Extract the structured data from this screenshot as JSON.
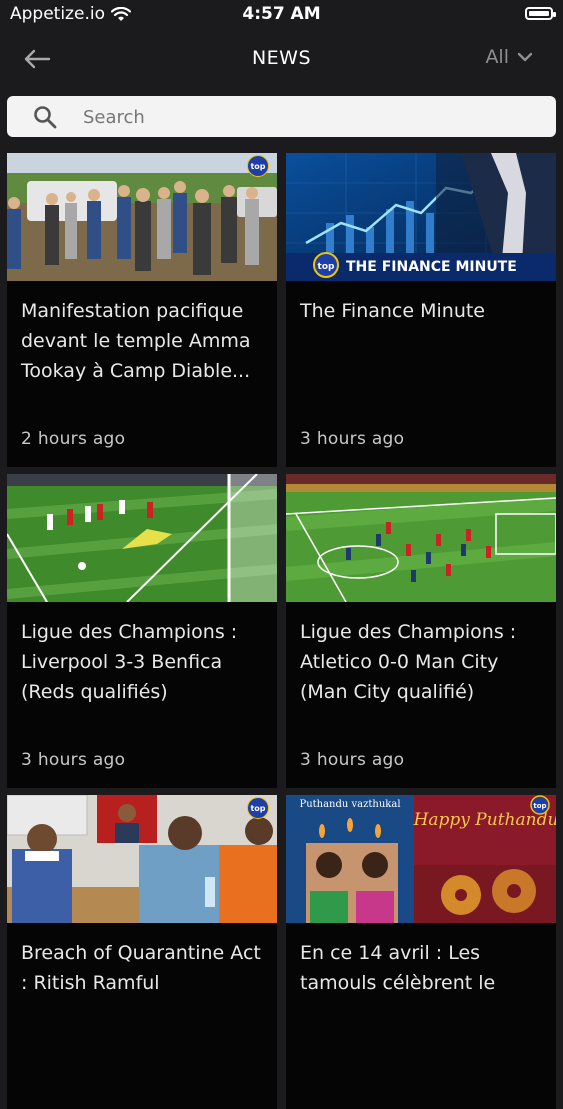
{
  "status_bar": {
    "carrier": "Appetize.io",
    "time": "4:57 AM"
  },
  "nav": {
    "title": "NEWS",
    "filter_label": "All"
  },
  "search": {
    "placeholder": "Search"
  },
  "cards": [
    {
      "title": "Manifestation pacifique devant le temple Amma Tookay à Camp Diable...",
      "time": "2 hours ago",
      "thumbnail": "protest-crowd-police"
    },
    {
      "title": "The Finance Minute",
      "time": "3 hours ago",
      "thumbnail": "finance-chart",
      "thumb_text": "THE FINANCE MINUTE"
    },
    {
      "title": "Ligue des Champions : Liverpool 3-3 Benfica (Reds qualifiés)",
      "time": "3 hours ago",
      "thumbnail": "football-goalkeeper-dive"
    },
    {
      "title": "Ligue des Champions : Atletico 0-0 Man City (Man City qualifié)",
      "time": "3 hours ago",
      "thumbnail": "football-pitch-wide"
    },
    {
      "title": "Breach of Quarantine Act : Ritish Ramful",
      "time": "",
      "thumbnail": "press-conference"
    },
    {
      "title": "En ce 14 avril : Les tamouls célèbrent le",
      "time": "",
      "thumbnail": "puthandu-greeting",
      "thumb_text_1": "Puthandu vazthukal",
      "thumb_text_2": "Happy Puthandu"
    }
  ],
  "logo_text": "top",
  "colors": {
    "background": "#1b1b1d",
    "card": "#050505",
    "accent_blue": "#1f3fa8",
    "muted": "#8e8e93"
  }
}
